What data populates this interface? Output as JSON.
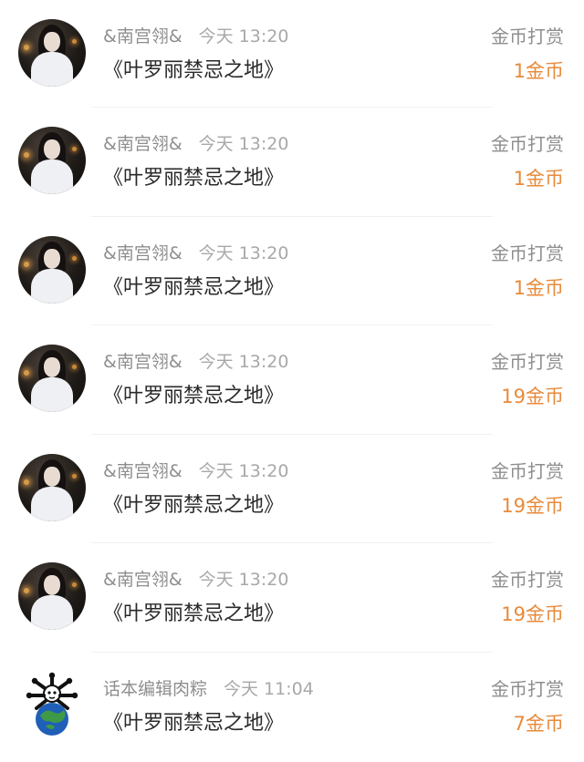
{
  "rewards": [
    {
      "user": "&南宫翎&",
      "time": "今天 13:20",
      "book": "《叶罗丽禁忌之地》",
      "type": "金币打赏",
      "amount": "1金币",
      "avatar": "portrait"
    },
    {
      "user": "&南宫翎&",
      "time": "今天 13:20",
      "book": "《叶罗丽禁忌之地》",
      "type": "金币打赏",
      "amount": "1金币",
      "avatar": "portrait"
    },
    {
      "user": "&南宫翎&",
      "time": "今天 13:20",
      "book": "《叶罗丽禁忌之地》",
      "type": "金币打赏",
      "amount": "1金币",
      "avatar": "portrait"
    },
    {
      "user": "&南宫翎&",
      "time": "今天 13:20",
      "book": "《叶罗丽禁忌之地》",
      "type": "金币打赏",
      "amount": "19金币",
      "avatar": "portrait"
    },
    {
      "user": "&南宫翎&",
      "time": "今天 13:20",
      "book": "《叶罗丽禁忌之地》",
      "type": "金币打赏",
      "amount": "19金币",
      "avatar": "portrait"
    },
    {
      "user": "&南宫翎&",
      "time": "今天 13:20",
      "book": "《叶罗丽禁忌之地》",
      "type": "金币打赏",
      "amount": "19金币",
      "avatar": "portrait"
    },
    {
      "user": "话本编辑肉粽",
      "time": "今天 11:04",
      "book": "《叶罗丽禁忌之地》",
      "type": "金币打赏",
      "amount": "7金币",
      "avatar": "earth-character"
    }
  ],
  "colors": {
    "amount": "#e88a3a",
    "meta": "#8e8e8e",
    "title": "#2a2a2a"
  }
}
